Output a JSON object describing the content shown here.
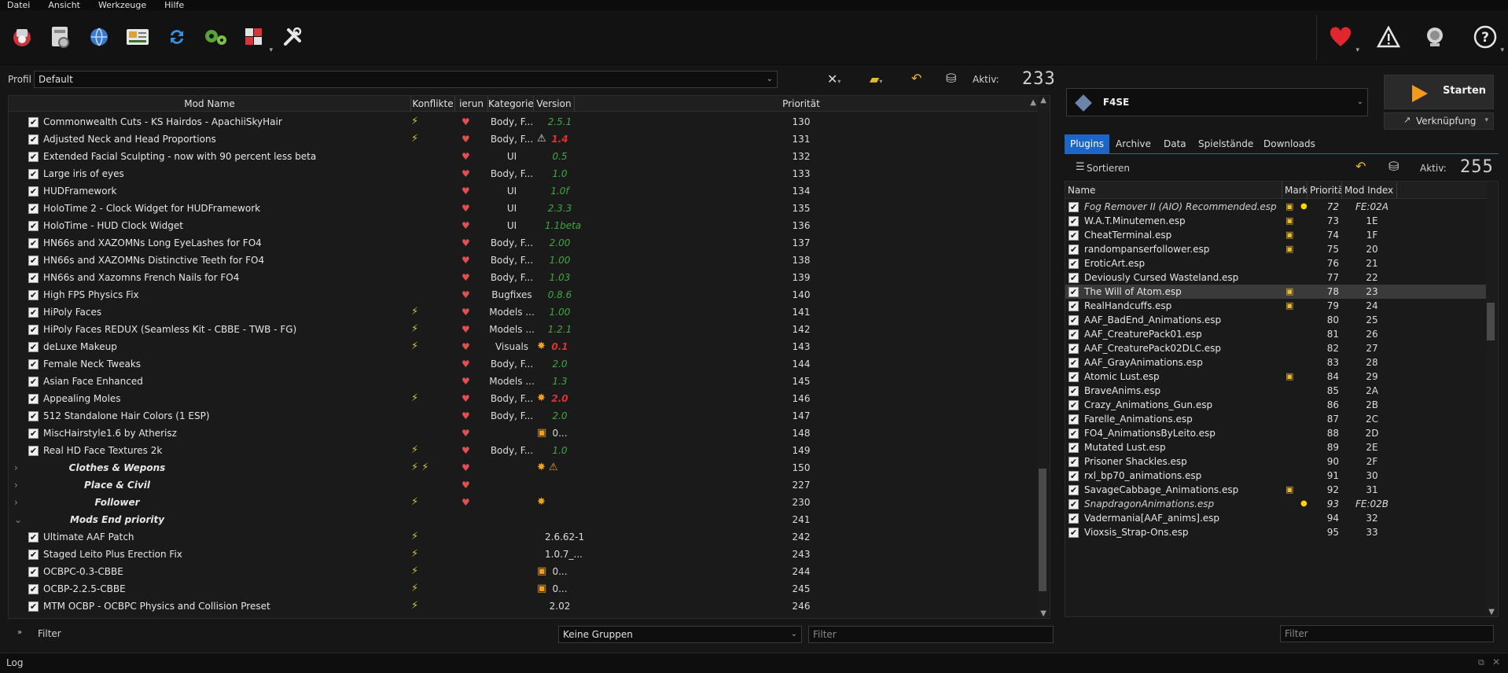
{
  "menu": [
    "Datei",
    "Ansicht",
    "Werkzeuge",
    "Hilfe"
  ],
  "toolbar_icons": [
    "instance-icon",
    "install-mod-icon",
    "nexus-globe-icon",
    "nexus-id-card-icon",
    "refresh-icon",
    "settings-gears-icon",
    "executables-icon",
    "tools-icon"
  ],
  "toolbar_right_icons": [
    "heart-icon",
    "warning-icon",
    "update-icon",
    "help-icon"
  ],
  "profile": {
    "label": "Profil",
    "value": "Default",
    "active_label": "Aktiv:",
    "active_count": "233"
  },
  "mods": {
    "headers": [
      "Mod Name",
      "Konflikte",
      "ierun",
      "Kategorie",
      "Version",
      "Priorität"
    ],
    "rows": [
      {
        "name": "Commonwealth Cuts - KS Hairdos - ApachiiSkyHair",
        "checked": true,
        "conf": "⚡",
        "cat": "Body, F...",
        "ver": "2.5.1",
        "prio": "130"
      },
      {
        "name": "Adjusted Neck and Head Proportions",
        "checked": true,
        "conf": "⚡",
        "cat": "Body, F...",
        "ci": "⚠",
        "ver": "1.4",
        "vc": "bad",
        "prio": "131"
      },
      {
        "name": "Extended Facial Sculpting - now with 90 percent less beta",
        "checked": true,
        "conf": "",
        "cat": "UI",
        "ver": "0.5",
        "prio": "132"
      },
      {
        "name": "Large iris of eyes",
        "checked": true,
        "conf": "",
        "cat": "Body, F...",
        "ver": "1.0",
        "prio": "133"
      },
      {
        "name": "HUDFramework",
        "checked": true,
        "conf": "",
        "cat": "UI",
        "ver": "1.0f",
        "prio": "134"
      },
      {
        "name": "HoloTime 2 - Clock Widget for HUDFramework",
        "checked": true,
        "conf": "",
        "cat": "UI",
        "ver": "2.3.3",
        "prio": "135"
      },
      {
        "name": "HoloTime - HUD Clock Widget",
        "checked": true,
        "conf": "",
        "cat": "UI",
        "ver": "1.1beta",
        "prio": "136"
      },
      {
        "name": "HN66s and XAZOMNs Long EyeLashes for FO4",
        "checked": true,
        "conf": "",
        "cat": "Body, F...",
        "ver": "2.00",
        "prio": "137"
      },
      {
        "name": "HN66s and XAZOMNs Distinctive Teeth for FO4",
        "checked": true,
        "conf": "",
        "cat": "Body, F...",
        "ver": "1.00",
        "prio": "138"
      },
      {
        "name": "HN66s and Xazomns French Nails for FO4",
        "checked": true,
        "conf": "",
        "cat": "Body, F...",
        "ver": "1.03",
        "prio": "139"
      },
      {
        "name": "High FPS Physics Fix",
        "checked": true,
        "conf": "",
        "cat": "Bugfixes",
        "ver": "0.8.6",
        "prio": "140"
      },
      {
        "name": "HiPoly Faces",
        "checked": true,
        "conf": "⚡",
        "cat": "Models ...",
        "ver": "1.00",
        "prio": "141"
      },
      {
        "name": "HiPoly Faces REDUX (Seamless Kit - CBBE - TWB - FG)",
        "checked": true,
        "conf": "⚡",
        "cat": "Models ...",
        "ver": "1.2.1",
        "prio": "142"
      },
      {
        "name": "deLuxe Makeup",
        "checked": true,
        "conf": "⚡",
        "cat": "Visuals",
        "ci": "✸",
        "ver": "0.1",
        "vc": "bad",
        "prio": "143"
      },
      {
        "name": "Female Neck Tweaks",
        "checked": true,
        "conf": "",
        "cat": "Body, F...",
        "ver": "2.0",
        "prio": "144"
      },
      {
        "name": "Asian Face Enhanced",
        "checked": true,
        "conf": "",
        "cat": "Models ...",
        "ver": "1.3",
        "prio": "145"
      },
      {
        "name": "Appealing Moles",
        "checked": true,
        "conf": "⚡",
        "cat": "Body, F...",
        "ci": "✸",
        "ver": "2.0",
        "vc": "bad",
        "prio": "146"
      },
      {
        "name": "512 Standalone Hair Colors (1 ESP)",
        "checked": true,
        "conf": "",
        "cat": "Body, F...",
        "ver": "2.0",
        "prio": "147"
      },
      {
        "name": "MiscHairstyle1.6 by Atherisz",
        "checked": true,
        "conf": "",
        "cat": "",
        "ci": "▣",
        "ver": "0...",
        "vc": "plain",
        "prio": "148"
      },
      {
        "name": "Real HD Face Textures 2k",
        "checked": true,
        "conf": "⚡",
        "cat": "Body, F...",
        "ver": "1.0",
        "prio": "149"
      },
      {
        "name": "Clothes & Wepons",
        "sep": true,
        "chev": "›",
        "conf": "⚡ ⚡",
        "ci": "✸ ⚠",
        "prio": "150"
      },
      {
        "name": "Place & Civil",
        "sep": true,
        "chev": "›",
        "conf": "",
        "prio": "227"
      },
      {
        "name": "Follower",
        "sep": true,
        "chev": "›",
        "conf": "⚡",
        "ci": "✸",
        "prio": "230"
      },
      {
        "name": "Mods End priority",
        "sep": true,
        "chev": "⌄",
        "conf": "",
        "noflag": true,
        "prio": "241"
      },
      {
        "name": "Ultimate AAF Patch",
        "checked": true,
        "conf": "⚡",
        "noflag": true,
        "cat": "",
        "ver": "2.6.62-1",
        "vc": "plain",
        "prio": "242"
      },
      {
        "name": "Staged Leito Plus Erection Fix",
        "checked": true,
        "conf": "⚡",
        "noflag": true,
        "cat": "",
        "ver": "1.0.7_...",
        "vc": "plain",
        "prio": "243"
      },
      {
        "name": "OCBPC-0.3-CBBE",
        "checked": true,
        "conf": "⚡",
        "noflag": true,
        "cat": "",
        "ci": "▣",
        "ver": "0...",
        "vc": "plain",
        "prio": "244"
      },
      {
        "name": "OCBP-2.2.5-CBBE",
        "checked": true,
        "conf": "⚡",
        "noflag": true,
        "cat": "",
        "ci": "▣",
        "ver": "0...",
        "vc": "plain",
        "prio": "245"
      },
      {
        "name": "MTM OCBP - OCBPC Physics and Collision Preset",
        "checked": true,
        "conf": "⚡",
        "noflag": true,
        "cat": "",
        "ver": "2.02",
        "vc": "plain",
        "prio": "246"
      }
    ]
  },
  "bottom": {
    "filter_label": "Filter",
    "groups_value": "Keine Gruppen",
    "filter_placeholder": "Filter"
  },
  "log_label": "Log",
  "right": {
    "executable": "F4SE",
    "run_label": "Starten",
    "shortcut_label": "Verknüpfung",
    "tabs": [
      "Plugins",
      "Archive",
      "Data",
      "Spielstände",
      "Downloads"
    ],
    "sort_label": "Sortieren",
    "active_label": "Aktiv:",
    "active_count": "255",
    "plugin_headers": [
      "Name",
      "Marke",
      "Priorität",
      "Mod Index"
    ],
    "plugins": [
      {
        "name": "Fog Remover II (AIO) Recommended.esp",
        "it": true,
        "m1": true,
        "m2": true,
        "prio": "72",
        "idx": "FE:02A"
      },
      {
        "name": "W.A.T.Minutemen.esp",
        "m1": true,
        "prio": "73",
        "idx": "1E"
      },
      {
        "name": "CheatTerminal.esp",
        "m1": true,
        "prio": "74",
        "idx": "1F"
      },
      {
        "name": "randompanserfollower.esp",
        "m1": true,
        "prio": "75",
        "idx": "20"
      },
      {
        "name": "EroticArt.esp",
        "prio": "76",
        "idx": "21"
      },
      {
        "name": "Deviously Cursed Wasteland.esp",
        "prio": "77",
        "idx": "22"
      },
      {
        "name": "The Will of Atom.esp",
        "m1": true,
        "sel": true,
        "prio": "78",
        "idx": "23"
      },
      {
        "name": "RealHandcuffs.esp",
        "m1": true,
        "prio": "79",
        "idx": "24"
      },
      {
        "name": "AAF_BadEnd_Animations.esp",
        "prio": "80",
        "idx": "25"
      },
      {
        "name": "AAF_CreaturePack01.esp",
        "prio": "81",
        "idx": "26"
      },
      {
        "name": "AAF_CreaturePack02DLC.esp",
        "prio": "82",
        "idx": "27"
      },
      {
        "name": "AAF_GrayAnimations.esp",
        "prio": "83",
        "idx": "28"
      },
      {
        "name": "Atomic Lust.esp",
        "m1": true,
        "prio": "84",
        "idx": "29"
      },
      {
        "name": "BraveAnims.esp",
        "prio": "85",
        "idx": "2A"
      },
      {
        "name": "Crazy_Animations_Gun.esp",
        "prio": "86",
        "idx": "2B"
      },
      {
        "name": "Farelle_Animations.esp",
        "prio": "87",
        "idx": "2C"
      },
      {
        "name": "FO4_AnimationsByLeito.esp",
        "prio": "88",
        "idx": "2D"
      },
      {
        "name": "Mutated Lust.esp",
        "prio": "89",
        "idx": "2E"
      },
      {
        "name": "Prisoner Shackles.esp",
        "prio": "90",
        "idx": "2F"
      },
      {
        "name": "rxl_bp70_animations.esp",
        "prio": "91",
        "idx": "30"
      },
      {
        "name": "SavageCabbage_Animations.esp",
        "m1": true,
        "prio": "92",
        "idx": "31"
      },
      {
        "name": "SnapdragonAnimations.esp",
        "it": true,
        "m2": true,
        "prio": "93",
        "idx": "FE:02B"
      },
      {
        "name": "Vadermania[AAF_anims].esp",
        "prio": "94",
        "idx": "32"
      },
      {
        "name": "Vioxsis_Strap-Ons.esp",
        "prio": "95",
        "idx": "33"
      }
    ],
    "filter_placeholder": "Filter"
  },
  "colors": {
    "accent": "#1d66c9",
    "version_ok": "#3fa83f",
    "version_bad": "#e03030",
    "run_arrow": "#f39a1e"
  }
}
